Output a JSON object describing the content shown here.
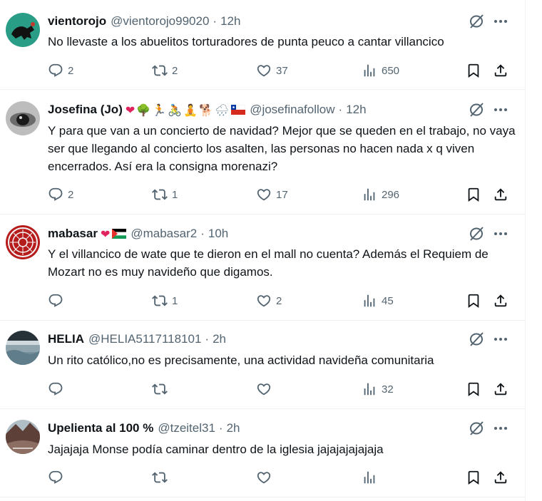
{
  "tweets": [
    {
      "name": "vientorojo",
      "handle": "@vientorojo99020",
      "time": "12h",
      "text": "No llevaste a los abuelitos torturadores de punta peuco a cantar villancico",
      "replies": "2",
      "reposts": "2",
      "likes": "37",
      "views": "650"
    },
    {
      "name": "Josefina (Jo)",
      "handle": "@josefinafollow",
      "time": "12h",
      "text": "Y para que van a un concierto de navidad? Mejor que se queden en el trabajo, no vaya ser que llegando al concierto los asalten, las personas no hacen nada x q viven encerrados. Así era la consigna morenazi?",
      "replies": "2",
      "reposts": "1",
      "likes": "17",
      "views": "296"
    },
    {
      "name": "mabasar",
      "handle": "@mabasar2",
      "time": "10h",
      "text": "Y el villancico de wate que te dieron en el mall no cuenta? Además el Requiem de Mozart no es muy navideño que digamos.",
      "replies": "",
      "reposts": "1",
      "likes": "2",
      "views": "45"
    },
    {
      "name": "HELIA",
      "handle": "@HELIA5117118101",
      "time": "2h",
      "text": "Un rito católico,no es precisamente, una actividad navideña comunitaria",
      "replies": "",
      "reposts": "",
      "likes": "",
      "views": "32"
    },
    {
      "name": "Upelienta al 100 %",
      "handle": "@tzeitel31",
      "time": "2h",
      "text": "Jajajaja Monse podía caminar dentro de la iglesia jajajajajajaja",
      "replies": "",
      "reposts": "",
      "likes": "",
      "views": ""
    }
  ],
  "sep": "·",
  "emojis": {
    "josefina": [
      "❤",
      "🌳",
      "🏃",
      "🚴",
      "🧘",
      "🐕",
      "🌧"
    ],
    "mabasar": [
      "❤"
    ]
  },
  "icons": {
    "reply": "reply-icon",
    "repost": "repost-icon",
    "like": "heart-icon",
    "views": "views-icon",
    "bookmark": "bookmark-icon",
    "share": "share-icon",
    "grok": "grok-icon",
    "more": "more-icon"
  },
  "colors": {
    "text": "#0f1419",
    "muted": "#536471",
    "heart": "#f91880",
    "border": "#eff3f4"
  }
}
